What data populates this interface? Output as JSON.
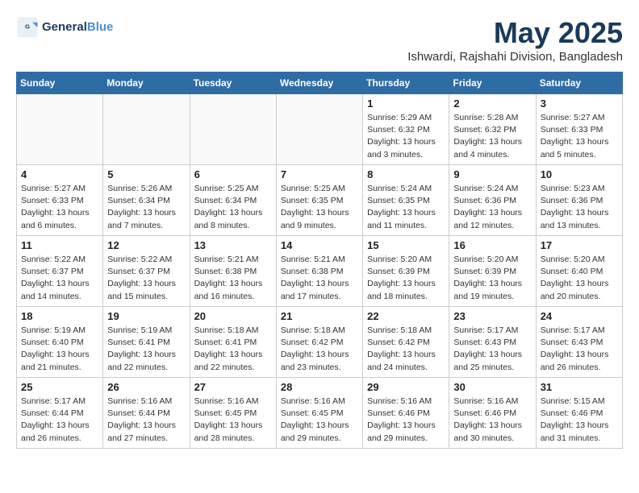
{
  "logo": {
    "line1": "General",
    "line2": "Blue"
  },
  "title": "May 2025",
  "subtitle": "Ishwardi, Rajshahi Division, Bangladesh",
  "days_of_week": [
    "Sunday",
    "Monday",
    "Tuesday",
    "Wednesday",
    "Thursday",
    "Friday",
    "Saturday"
  ],
  "weeks": [
    [
      {
        "day": "",
        "info": ""
      },
      {
        "day": "",
        "info": ""
      },
      {
        "day": "",
        "info": ""
      },
      {
        "day": "",
        "info": ""
      },
      {
        "day": "1",
        "info": "Sunrise: 5:29 AM\nSunset: 6:32 PM\nDaylight: 13 hours\nand 3 minutes."
      },
      {
        "day": "2",
        "info": "Sunrise: 5:28 AM\nSunset: 6:32 PM\nDaylight: 13 hours\nand 4 minutes."
      },
      {
        "day": "3",
        "info": "Sunrise: 5:27 AM\nSunset: 6:33 PM\nDaylight: 13 hours\nand 5 minutes."
      }
    ],
    [
      {
        "day": "4",
        "info": "Sunrise: 5:27 AM\nSunset: 6:33 PM\nDaylight: 13 hours\nand 6 minutes."
      },
      {
        "day": "5",
        "info": "Sunrise: 5:26 AM\nSunset: 6:34 PM\nDaylight: 13 hours\nand 7 minutes."
      },
      {
        "day": "6",
        "info": "Sunrise: 5:25 AM\nSunset: 6:34 PM\nDaylight: 13 hours\nand 8 minutes."
      },
      {
        "day": "7",
        "info": "Sunrise: 5:25 AM\nSunset: 6:35 PM\nDaylight: 13 hours\nand 9 minutes."
      },
      {
        "day": "8",
        "info": "Sunrise: 5:24 AM\nSunset: 6:35 PM\nDaylight: 13 hours\nand 11 minutes."
      },
      {
        "day": "9",
        "info": "Sunrise: 5:24 AM\nSunset: 6:36 PM\nDaylight: 13 hours\nand 12 minutes."
      },
      {
        "day": "10",
        "info": "Sunrise: 5:23 AM\nSunset: 6:36 PM\nDaylight: 13 hours\nand 13 minutes."
      }
    ],
    [
      {
        "day": "11",
        "info": "Sunrise: 5:22 AM\nSunset: 6:37 PM\nDaylight: 13 hours\nand 14 minutes."
      },
      {
        "day": "12",
        "info": "Sunrise: 5:22 AM\nSunset: 6:37 PM\nDaylight: 13 hours\nand 15 minutes."
      },
      {
        "day": "13",
        "info": "Sunrise: 5:21 AM\nSunset: 6:38 PM\nDaylight: 13 hours\nand 16 minutes."
      },
      {
        "day": "14",
        "info": "Sunrise: 5:21 AM\nSunset: 6:38 PM\nDaylight: 13 hours\nand 17 minutes."
      },
      {
        "day": "15",
        "info": "Sunrise: 5:20 AM\nSunset: 6:39 PM\nDaylight: 13 hours\nand 18 minutes."
      },
      {
        "day": "16",
        "info": "Sunrise: 5:20 AM\nSunset: 6:39 PM\nDaylight: 13 hours\nand 19 minutes."
      },
      {
        "day": "17",
        "info": "Sunrise: 5:20 AM\nSunset: 6:40 PM\nDaylight: 13 hours\nand 20 minutes."
      }
    ],
    [
      {
        "day": "18",
        "info": "Sunrise: 5:19 AM\nSunset: 6:40 PM\nDaylight: 13 hours\nand 21 minutes."
      },
      {
        "day": "19",
        "info": "Sunrise: 5:19 AM\nSunset: 6:41 PM\nDaylight: 13 hours\nand 22 minutes."
      },
      {
        "day": "20",
        "info": "Sunrise: 5:18 AM\nSunset: 6:41 PM\nDaylight: 13 hours\nand 22 minutes."
      },
      {
        "day": "21",
        "info": "Sunrise: 5:18 AM\nSunset: 6:42 PM\nDaylight: 13 hours\nand 23 minutes."
      },
      {
        "day": "22",
        "info": "Sunrise: 5:18 AM\nSunset: 6:42 PM\nDaylight: 13 hours\nand 24 minutes."
      },
      {
        "day": "23",
        "info": "Sunrise: 5:17 AM\nSunset: 6:43 PM\nDaylight: 13 hours\nand 25 minutes."
      },
      {
        "day": "24",
        "info": "Sunrise: 5:17 AM\nSunset: 6:43 PM\nDaylight: 13 hours\nand 26 minutes."
      }
    ],
    [
      {
        "day": "25",
        "info": "Sunrise: 5:17 AM\nSunset: 6:44 PM\nDaylight: 13 hours\nand 26 minutes."
      },
      {
        "day": "26",
        "info": "Sunrise: 5:16 AM\nSunset: 6:44 PM\nDaylight: 13 hours\nand 27 minutes."
      },
      {
        "day": "27",
        "info": "Sunrise: 5:16 AM\nSunset: 6:45 PM\nDaylight: 13 hours\nand 28 minutes."
      },
      {
        "day": "28",
        "info": "Sunrise: 5:16 AM\nSunset: 6:45 PM\nDaylight: 13 hours\nand 29 minutes."
      },
      {
        "day": "29",
        "info": "Sunrise: 5:16 AM\nSunset: 6:46 PM\nDaylight: 13 hours\nand 29 minutes."
      },
      {
        "day": "30",
        "info": "Sunrise: 5:16 AM\nSunset: 6:46 PM\nDaylight: 13 hours\nand 30 minutes."
      },
      {
        "day": "31",
        "info": "Sunrise: 5:15 AM\nSunset: 6:46 PM\nDaylight: 13 hours\nand 31 minutes."
      }
    ]
  ]
}
